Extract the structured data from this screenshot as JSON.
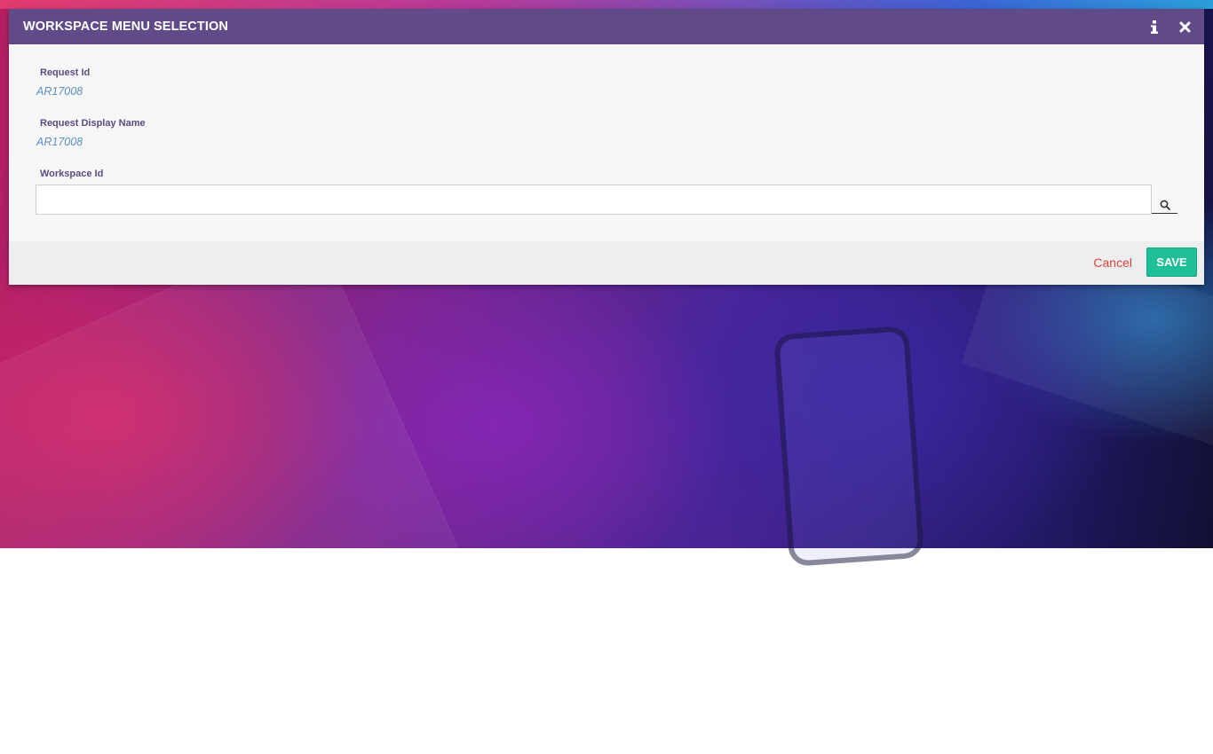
{
  "dialog": {
    "title": "WORKSPACE MENU SELECTION",
    "header_color": "#604a88"
  },
  "fields": {
    "request_id": {
      "label": "Request Id",
      "value": "AR17008"
    },
    "request_display_name": {
      "label": "Request Display Name",
      "value": "AR17008"
    },
    "workspace_id": {
      "label": "Workspace Id",
      "value": "",
      "placeholder": ""
    }
  },
  "footer": {
    "cancel_label": "Cancel",
    "save_label": "SAVE",
    "save_color": "#1fbf97",
    "cancel_color": "#d6453a"
  },
  "icons": {
    "info": "info-icon",
    "close": "close-icon",
    "search": "search-icon"
  }
}
